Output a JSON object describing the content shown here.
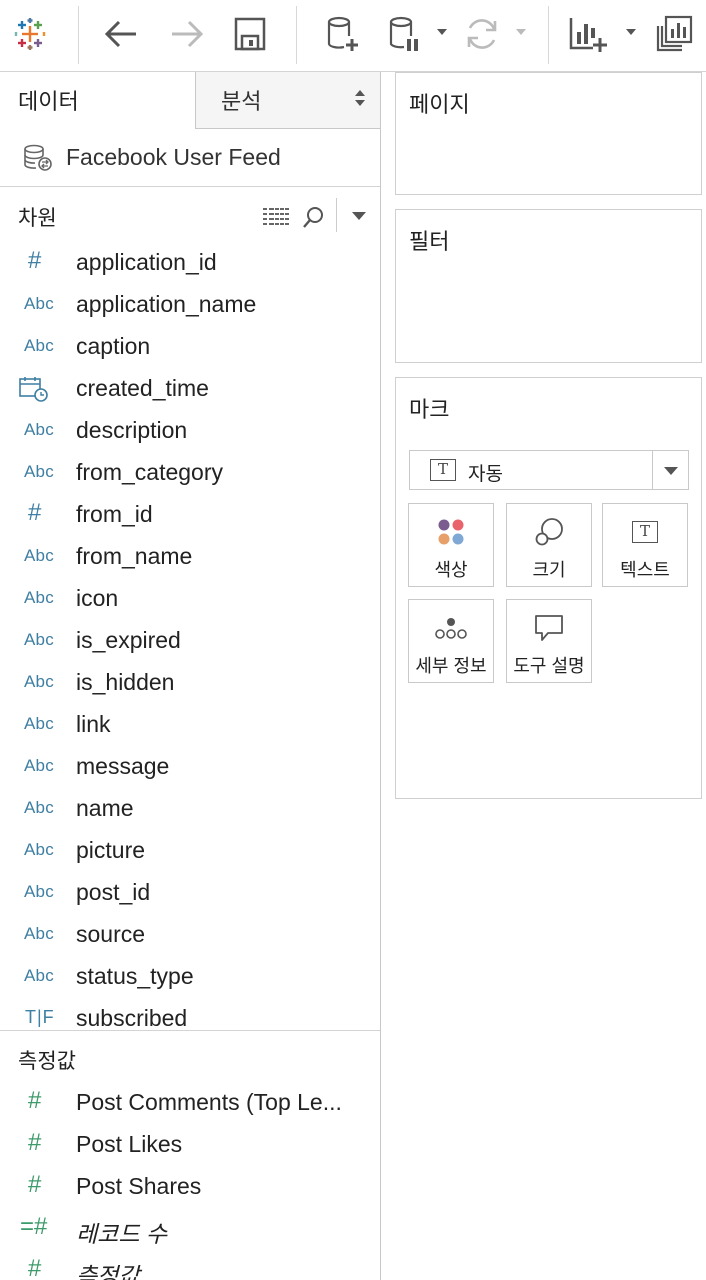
{
  "toolbar": {
    "icons": [
      "tableau-logo-icon",
      "back-icon",
      "forward-icon",
      "save-icon",
      "new-datasource-icon",
      "pause-updates-icon",
      "refresh-icon",
      "new-worksheet-icon",
      "show-me-icon"
    ]
  },
  "left_pane": {
    "tabs": {
      "data": "데이터",
      "analysis": "분석"
    },
    "datasource": {
      "name": "Facebook User Feed",
      "icon": "datasource-icon"
    },
    "dimensions": {
      "title": "차원",
      "fields": [
        {
          "name": "application_id",
          "type": "number"
        },
        {
          "name": "application_name",
          "type": "string"
        },
        {
          "name": "caption",
          "type": "string"
        },
        {
          "name": "created_time",
          "type": "datetime"
        },
        {
          "name": "description",
          "type": "string"
        },
        {
          "name": "from_category",
          "type": "string"
        },
        {
          "name": "from_id",
          "type": "number"
        },
        {
          "name": "from_name",
          "type": "string"
        },
        {
          "name": "icon",
          "type": "string"
        },
        {
          "name": "is_expired",
          "type": "string"
        },
        {
          "name": "is_hidden",
          "type": "string"
        },
        {
          "name": "link",
          "type": "string"
        },
        {
          "name": "message",
          "type": "string"
        },
        {
          "name": "name",
          "type": "string"
        },
        {
          "name": "picture",
          "type": "string"
        },
        {
          "name": "post_id",
          "type": "string"
        },
        {
          "name": "source",
          "type": "string"
        },
        {
          "name": "status_type",
          "type": "string"
        },
        {
          "name": "subscribed",
          "type": "boolean"
        }
      ]
    },
    "measures": {
      "title": "측정값",
      "fields": [
        {
          "name": "Post Comments (Top Le...",
          "type": "number"
        },
        {
          "name": "Post Likes",
          "type": "number"
        },
        {
          "name": "Post Shares",
          "type": "number"
        },
        {
          "name": "레코드 수",
          "type": "count"
        },
        {
          "name": "측정값",
          "type": "number"
        }
      ]
    },
    "type_labels": {
      "string": "Abc",
      "number": "#",
      "boolean": "T|F",
      "count": "=#"
    }
  },
  "cards": {
    "pages": "페이지",
    "filters": "필터",
    "marks": {
      "title": "마크",
      "mark_type": "자동",
      "mark_type_icon": "T",
      "buttons": {
        "color": "색상",
        "size": "크기",
        "text": "텍스트",
        "detail": "세부 정보",
        "tooltip": "도구 설명"
      }
    }
  },
  "colors": {
    "dimension_icon": "#3e7fa3",
    "measure_icon": "#3d9a6b",
    "color_dots": [
      "#7a5c8f",
      "#e8636b",
      "#e8a06b",
      "#7fa8d4"
    ]
  }
}
